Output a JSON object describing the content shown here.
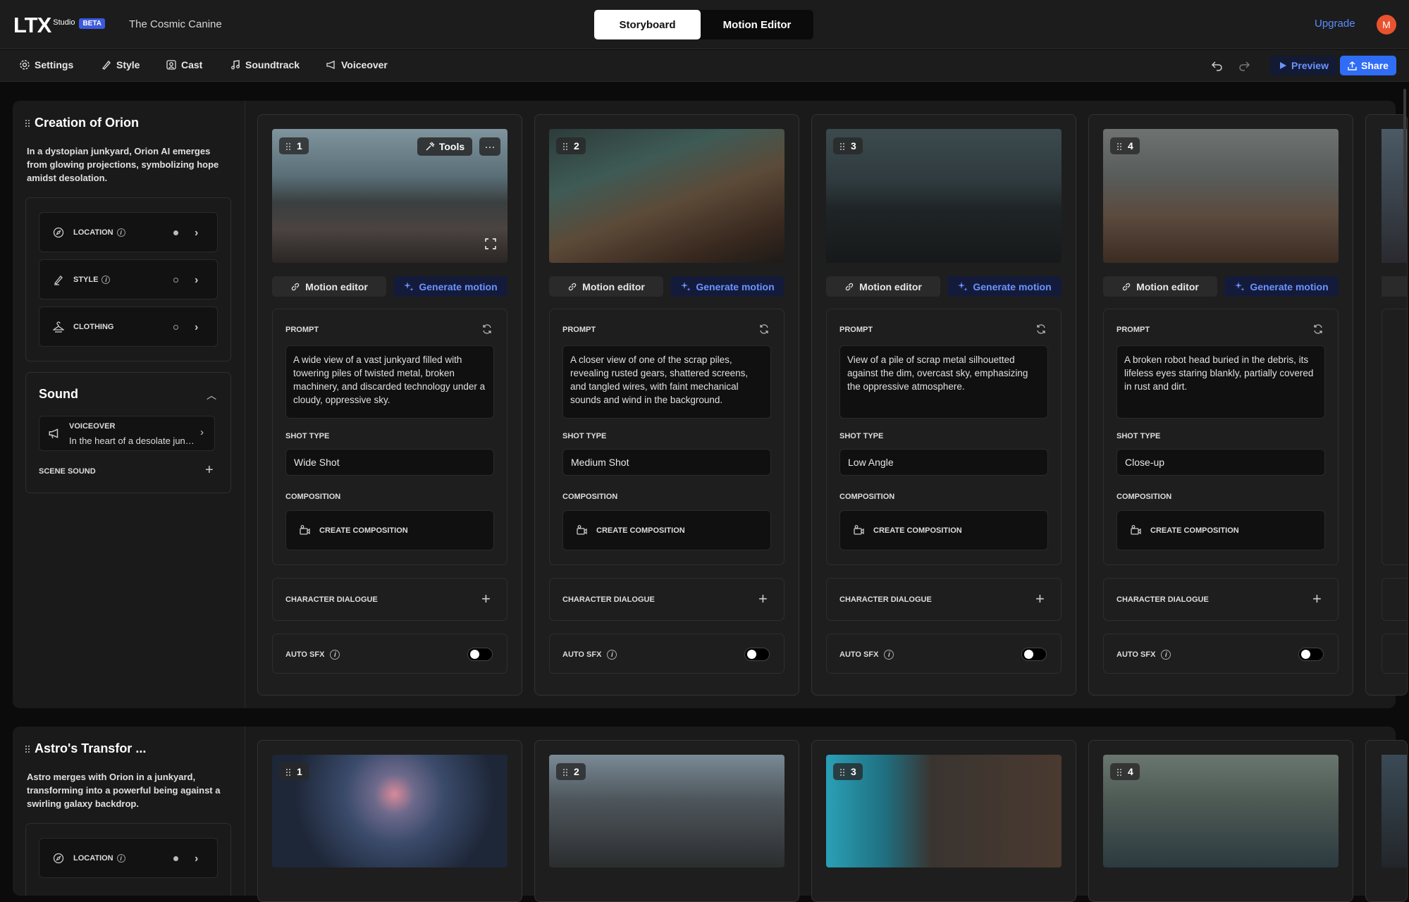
{
  "app": {
    "logo": "LTX",
    "logo_sub": "Studio",
    "badge": "BETA",
    "project_name": "The Cosmic Canine",
    "tabs": [
      "Storyboard",
      "Motion Editor"
    ],
    "upgrade": "Upgrade",
    "avatar_initial": "M"
  },
  "toolbar": {
    "items": [
      "Settings",
      "Style",
      "Cast",
      "Soundtrack",
      "Voiceover"
    ],
    "preview": "Preview",
    "share": "Share"
  },
  "labels": {
    "motion_editor": "Motion editor",
    "generate_motion": "Generate motion",
    "prompt": "PROMPT",
    "shot_type": "SHOT TYPE",
    "composition": "COMPOSITION",
    "create_composition": "CREATE COMPOSITION",
    "character_dialogue": "CHARACTER DIALOGUE",
    "auto_sfx": "AUTO SFX",
    "tools": "Tools",
    "location": "LOCATION",
    "style": "STYLE",
    "clothing": "CLOTHING",
    "sound": "Sound",
    "voiceover": "VOICEOVER",
    "scene_sound": "SCENE SOUND"
  },
  "scenes": [
    {
      "title": "Creation of Orion",
      "description": "In a dystopian junkyard, Orion AI emerges from glowing projections, symbolizing hope amidst desolation.",
      "voiceover_text": "In the heart of a desolate junkyard",
      "shots": [
        {
          "num": "1",
          "prompt": "A wide view of a vast junkyard filled with towering piles of twisted metal, broken machinery, and discarded technology under a cloudy, oppressive sky.",
          "shot_type": "Wide Shot",
          "auto_sfx": false
        },
        {
          "num": "2",
          "prompt": "A closer view of one of the scrap piles, revealing rusted gears, shattered screens, and tangled wires, with faint mechanical sounds and wind in the background.",
          "shot_type": "Medium Shot",
          "auto_sfx": false
        },
        {
          "num": "3",
          "prompt": "View of a pile of scrap metal silhouetted against the dim, overcast sky, emphasizing the oppressive atmosphere.",
          "shot_type": "Low Angle",
          "auto_sfx": false
        },
        {
          "num": "4",
          "prompt": "A broken robot head buried in the debris, its lifeless eyes staring blankly, partially covered in rust and dirt.",
          "shot_type": "Close-up",
          "auto_sfx": false
        }
      ]
    },
    {
      "title": "Astro's Transfor  ...",
      "description": "Astro merges with Orion in a junkyard, transforming into a powerful being against a swirling galaxy backdrop.",
      "shots": [
        {
          "num": "1"
        },
        {
          "num": "2"
        },
        {
          "num": "3"
        },
        {
          "num": "4"
        }
      ]
    }
  ]
}
